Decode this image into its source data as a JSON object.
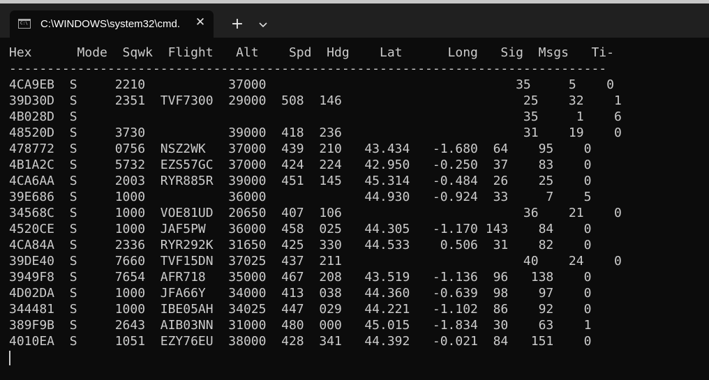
{
  "window": {
    "tab_title": "C:\\WINDOWS\\system32\\cmd.",
    "tab_icon": "cmd-icon",
    "tab_icon_text": "C:\\",
    "close_label": "✕",
    "new_tab_label": "+",
    "dropdown_icon": "chevron-down-icon"
  },
  "terminal": {
    "header": "Hex      Mode  Sqwk  Flight   Alt    Spd  Hdg    Lat      Long   Sig  Msgs   Ti-",
    "separator": "-------------------------------------------------------------------------------",
    "rows": [
      "4CA9EB  S     2210           37000                                 35     5    0",
      "39D30D  S     2351  TVF7300  29000  508  146                        25    32    1",
      "4B028D  S                                                           35     1    6",
      "48520D  S     3730           39000  418  236                        31    19    0",
      "478772  S     0756  NSZ2WK   37000  439  210   43.434   -1.680  64    95    0",
      "4B1A2C  S     5732  EZS57GC  37000  424  224   42.950   -0.250  37    83    0",
      "4CA6AA  S     2003  RYR885R  39000  451  145   45.314   -0.484  26    25    0",
      "39E686  S     1000           36000             44.930   -0.924  33     7    5",
      "34568C  S     1000  VOE81UD  20650  407  106                        36    21    0",
      "4520CE  S     1000  JAF5PW   36000  458  025   44.305   -1.170 143    84    0",
      "4CA84A  S     2336  RYR292K  31650  425  330   44.533    0.506  31    82    0",
      "39DE40  S     7660  TVF15DN  37025  437  211                        40    24    0",
      "3949F8  S     7654  AFR718   35000  467  208   43.519   -1.136  96   138    0",
      "4D02DA  S     1000  JFA66Y   34000  413  038   44.360   -0.639  98    97    0",
      "344481  S     1000  IBE05AH  34025  447  029   44.221   -1.102  86    92    0",
      "389F9B  S     2643  AIB03NN  31000  480  000   45.015   -1.834  30    63    1",
      "4010EA  S     1051  EZY76EU  38000  428  341   44.392   -0.021  84   151    0"
    ]
  },
  "colors": {
    "background": "#0c0c0c",
    "titlebar": "#202020",
    "text": "#cccccc"
  }
}
